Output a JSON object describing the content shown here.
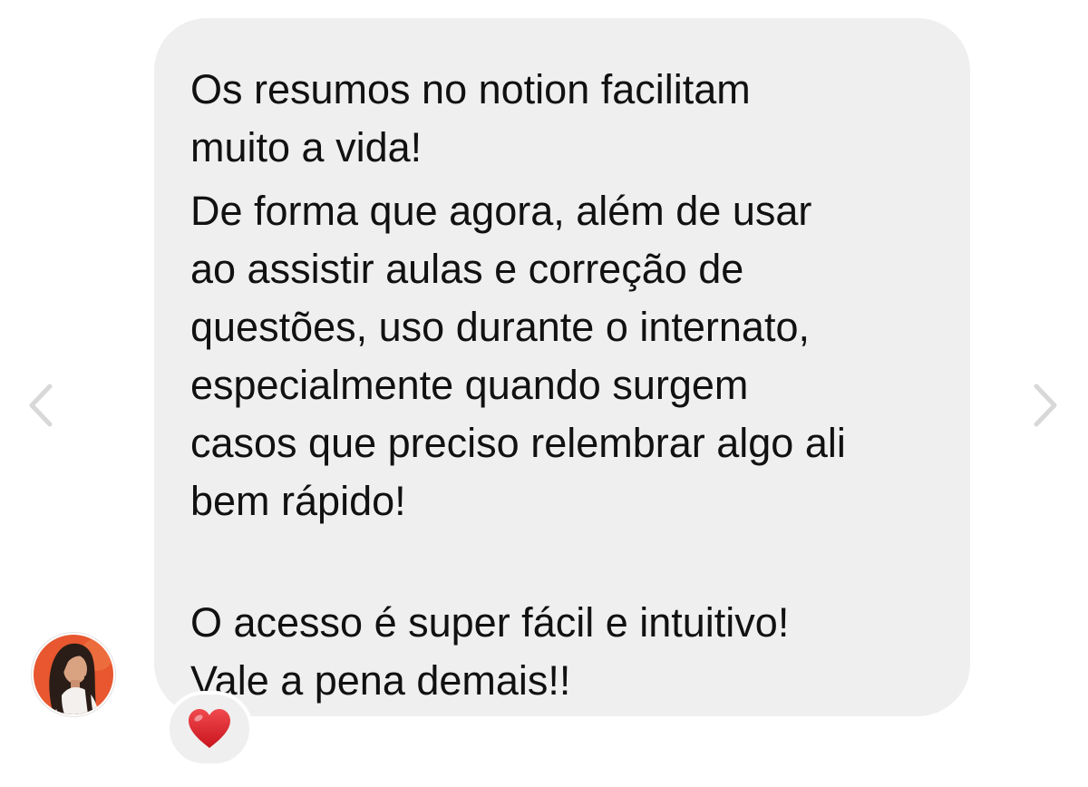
{
  "message": {
    "paragraph1": [
      "Os resumos no notion facilitam",
      "muito a vida!"
    ],
    "paragraph2": [
      "De forma que agora, além de usar",
      "ao assistir aulas e correção de",
      "questões, uso durante o internato,",
      "especialmente quando surgem",
      "casos que preciso relembrar algo ali",
      "bem rápido!"
    ],
    "paragraph3": [
      "O acesso é super fácil e intuitivo!",
      "Vale a pena demais!!"
    ]
  },
  "reaction": {
    "icon": "heart-icon",
    "color": "#e0242b"
  },
  "navigation": {
    "prev_icon": "chevron-left-icon",
    "next_icon": "chevron-right-icon",
    "arrow_color": "#d8d8d8"
  },
  "colors": {
    "bubble_background": "#efefef",
    "text": "#111111",
    "avatar_background": "#e8572f"
  }
}
